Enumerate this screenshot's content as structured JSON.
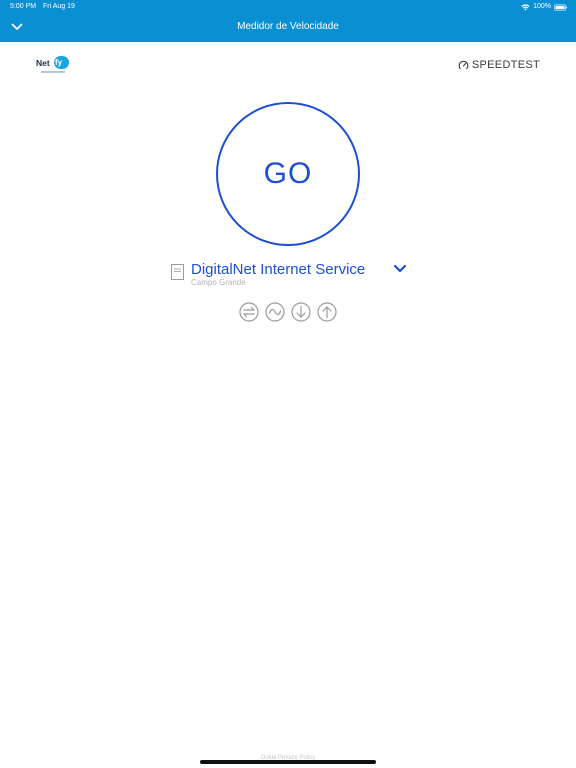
{
  "status_bar": {
    "time": "5:00 PM",
    "date": "Fri Aug 19",
    "battery": "100%"
  },
  "header": {
    "title": "Medidor de Velocidade",
    "back_icon": "chevron-down-icon"
  },
  "logo": {
    "text": "Net",
    "bubble_text": "fy"
  },
  "brand": {
    "label": "SPEEDTEST",
    "icon": "gauge-icon"
  },
  "go_button": {
    "label": "GO"
  },
  "server": {
    "name": "DigitalNet Internet Service",
    "location": "Campo Grande"
  },
  "modes": [
    {
      "icon": "connections-icon"
    },
    {
      "icon": "ping-icon"
    },
    {
      "icon": "download-icon"
    },
    {
      "icon": "upload-icon"
    }
  ],
  "footer": {
    "text": "Ookla Privacy Policy"
  },
  "colors": {
    "header_bg": "#0a8fd2",
    "accent": "#1c4fd1",
    "muted": "#b3b3b3"
  }
}
